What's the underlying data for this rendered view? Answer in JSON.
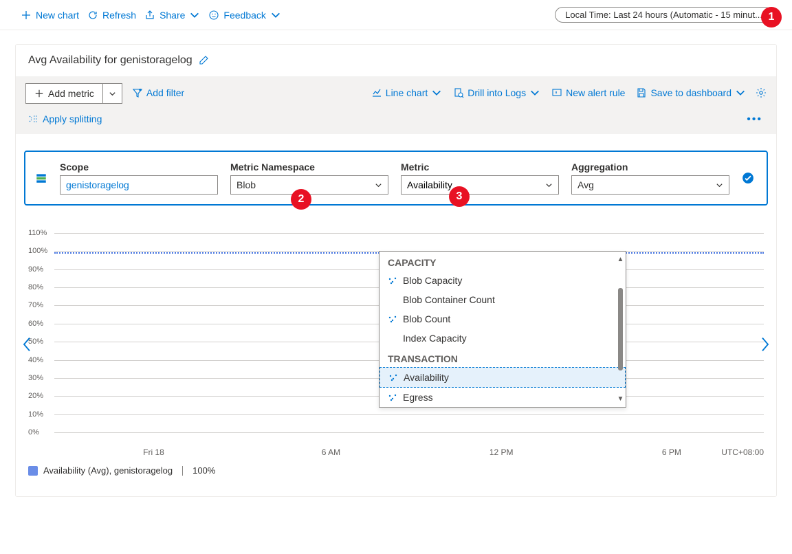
{
  "toolbar": {
    "new_chart": "New chart",
    "refresh": "Refresh",
    "share": "Share",
    "feedback": "Feedback",
    "time_text": "Local Time: Last 24 hours (Automatic - 15 minut..."
  },
  "callouts": {
    "c1": "1",
    "c2": "2",
    "c3": "3"
  },
  "card": {
    "title": "Avg Availability for genistoragelog"
  },
  "actions": {
    "add_metric": "Add metric",
    "add_filter": "Add filter",
    "apply_splitting": "Apply splitting",
    "line_chart": "Line chart",
    "drill_logs": "Drill into Logs",
    "new_alert": "New alert rule",
    "save_dashboard": "Save to dashboard"
  },
  "config": {
    "scope_label": "Scope",
    "scope_value": "genistoragelog",
    "namespace_label": "Metric Namespace",
    "namespace_value": "Blob",
    "metric_label": "Metric",
    "metric_value": "Availability",
    "aggregation_label": "Aggregation",
    "aggregation_value": "Avg"
  },
  "dropdown": {
    "group1": "CAPACITY",
    "items1": [
      "Blob Capacity",
      "Blob Container Count",
      "Blob Count",
      "Index Capacity"
    ],
    "group2": "TRANSACTION",
    "items2": [
      "Availability",
      "Egress"
    ]
  },
  "chart_data": {
    "type": "line",
    "title": "Avg Availability for genistoragelog",
    "ylabel": "",
    "ylim": [
      0,
      110
    ],
    "ytick_labels": [
      "110%",
      "100%",
      "90%",
      "80%",
      "70%",
      "60%",
      "50%",
      "40%",
      "30%",
      "20%",
      "10%",
      "0%"
    ],
    "x_labels": [
      "Fri 18",
      "6 AM",
      "12 PM",
      "6 PM"
    ],
    "timezone": "UTC+08:00",
    "series": [
      {
        "name": "Availability (Avg), genistoragelog",
        "value": 100,
        "constant": true,
        "percent_display": "100%"
      }
    ]
  },
  "legend": {
    "label": "Availability (Avg), genistoragelog",
    "value": "100%"
  }
}
